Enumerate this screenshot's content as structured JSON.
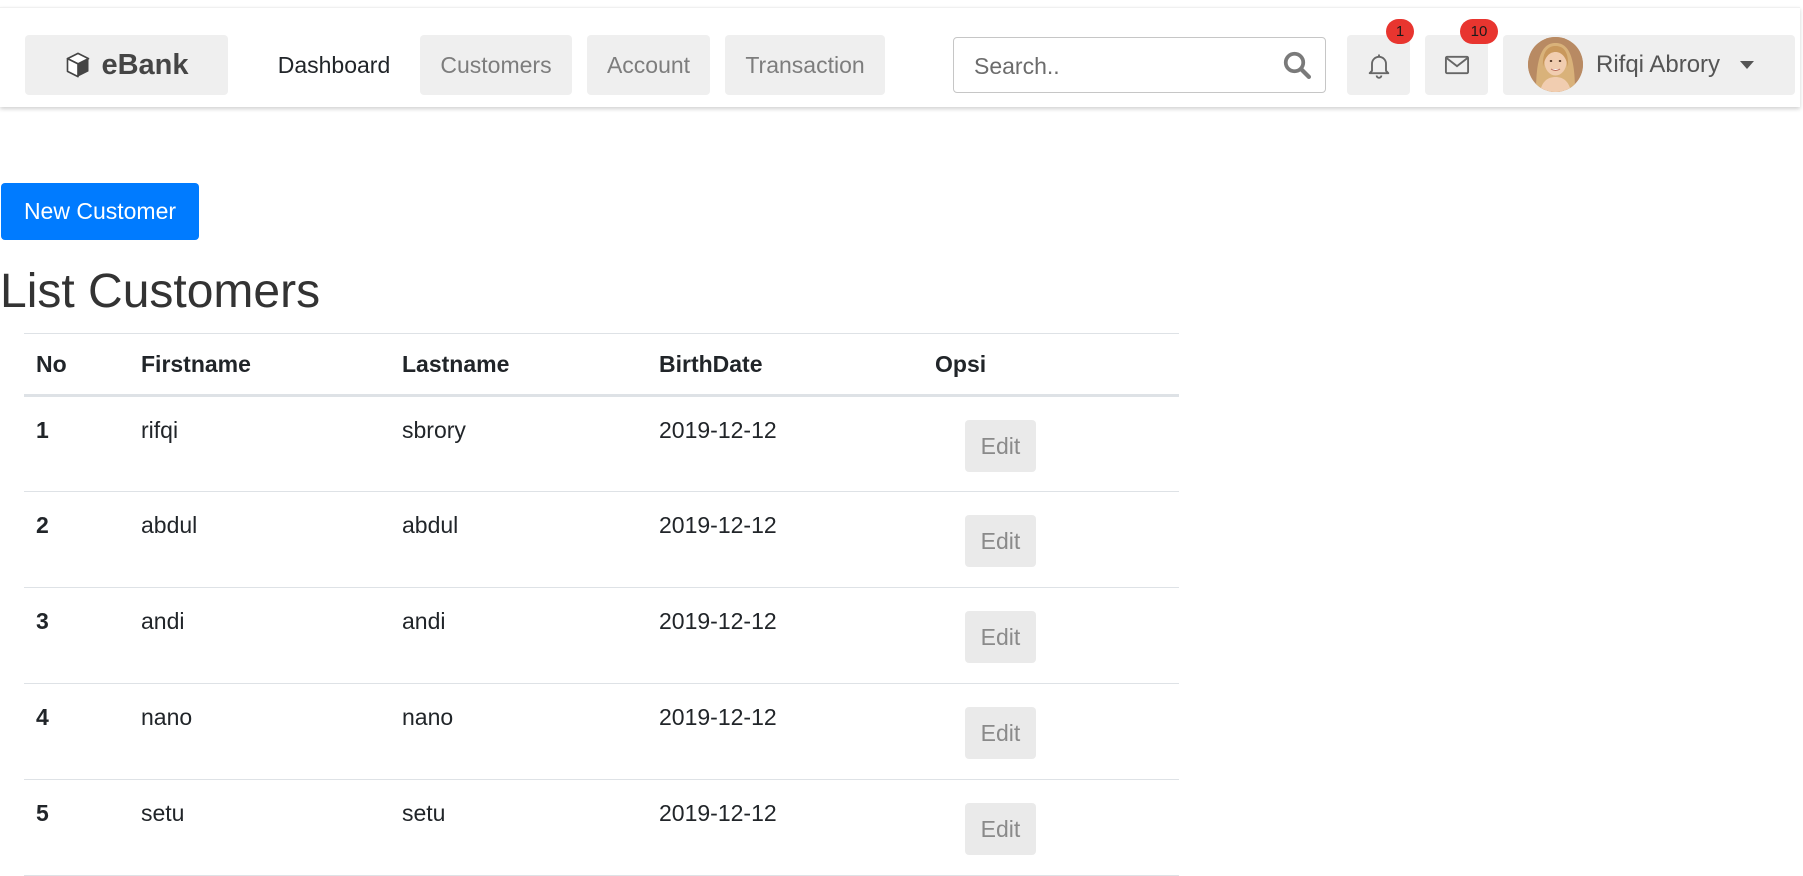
{
  "header": {
    "brand": {
      "label": "eBank",
      "icon": "box-icon"
    },
    "nav": [
      {
        "label": "Dashboard"
      },
      {
        "label": "Customers"
      },
      {
        "label": "Account"
      },
      {
        "label": "Transaction"
      }
    ],
    "search": {
      "placeholder": "Search..",
      "value": ""
    },
    "notifications": {
      "count": "1",
      "icon": "bell-icon"
    },
    "messages": {
      "count": "10",
      "icon": "envelope-icon"
    },
    "user": {
      "name": "Rifqi Abrory"
    }
  },
  "main": {
    "new_button": "New Customer",
    "title": "List Customers",
    "table": {
      "columns": [
        "No",
        "Firstname",
        "Lastname",
        "BirthDate",
        "Opsi"
      ],
      "rows": [
        {
          "no": "1",
          "firstname": "rifqi",
          "lastname": "sbrory",
          "birthdate": "2019-12-12",
          "action": "Edit"
        },
        {
          "no": "2",
          "firstname": "abdul",
          "lastname": "abdul",
          "birthdate": "2019-12-12",
          "action": "Edit"
        },
        {
          "no": "3",
          "firstname": "andi",
          "lastname": "andi",
          "birthdate": "2019-12-12",
          "action": "Edit"
        },
        {
          "no": "4",
          "firstname": "nano",
          "lastname": "nano",
          "birthdate": "2019-12-12",
          "action": "Edit"
        },
        {
          "no": "5",
          "firstname": "setu",
          "lastname": "setu",
          "birthdate": "2019-12-12",
          "action": "Edit"
        }
      ]
    }
  },
  "colors": {
    "primary": "#007bff",
    "badge": "#e8352f",
    "nav_button_bg": "#efefef"
  }
}
